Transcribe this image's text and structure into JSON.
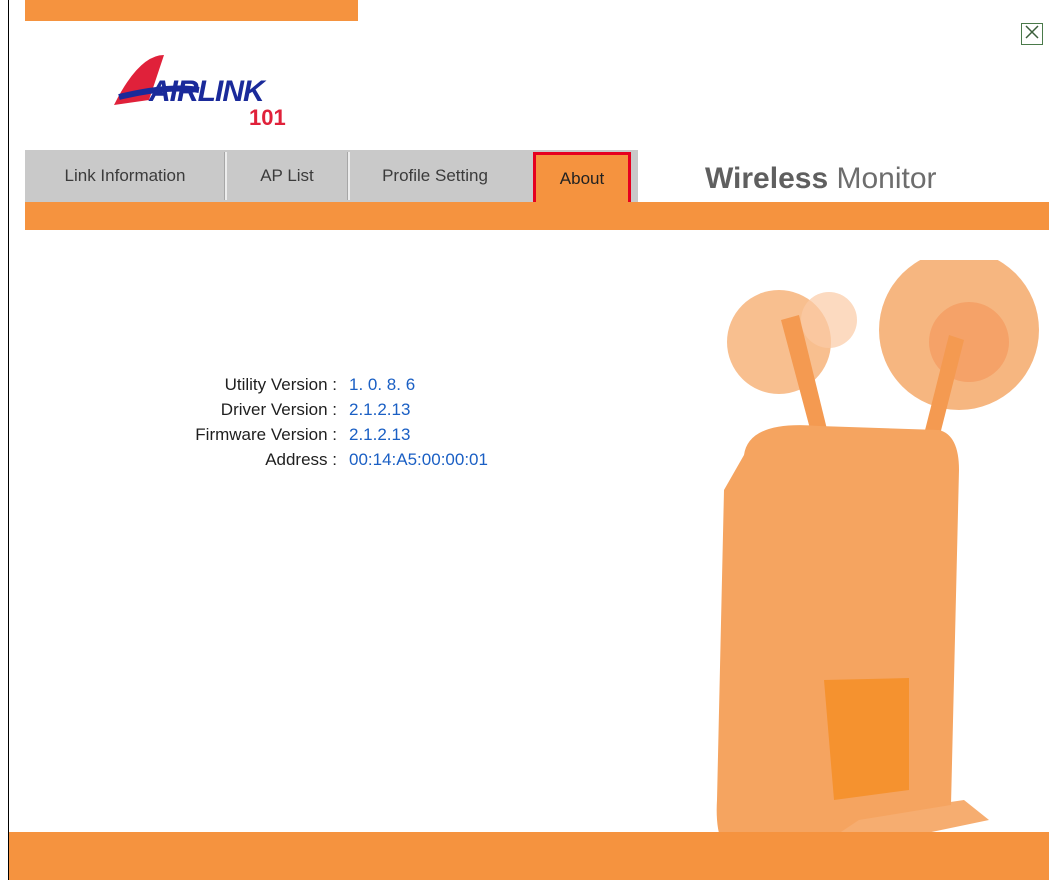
{
  "window": {
    "close_label": "Close"
  },
  "logo": {
    "text": "AIRLINK",
    "sub": "101"
  },
  "tabs": [
    {
      "label": "Link Information"
    },
    {
      "label": "AP List"
    },
    {
      "label": "Profile Setting"
    },
    {
      "label": "About"
    }
  ],
  "brand": {
    "bold": "Wireless",
    "regular": "Monitor"
  },
  "about": {
    "rows": [
      {
        "label": "Utility Version :",
        "value": "1. 0. 8. 6"
      },
      {
        "label": "Driver Version :",
        "value": "2.1.2.13"
      },
      {
        "label": "Firmware Version :",
        "value": "2.1.2.13"
      },
      {
        "label": "Address :",
        "value": "00:14:A5:00:00:01"
      }
    ]
  },
  "colors": {
    "accent": "#f5933f",
    "active_tab_border": "#e6001f",
    "value_text": "#1a5fc4"
  }
}
